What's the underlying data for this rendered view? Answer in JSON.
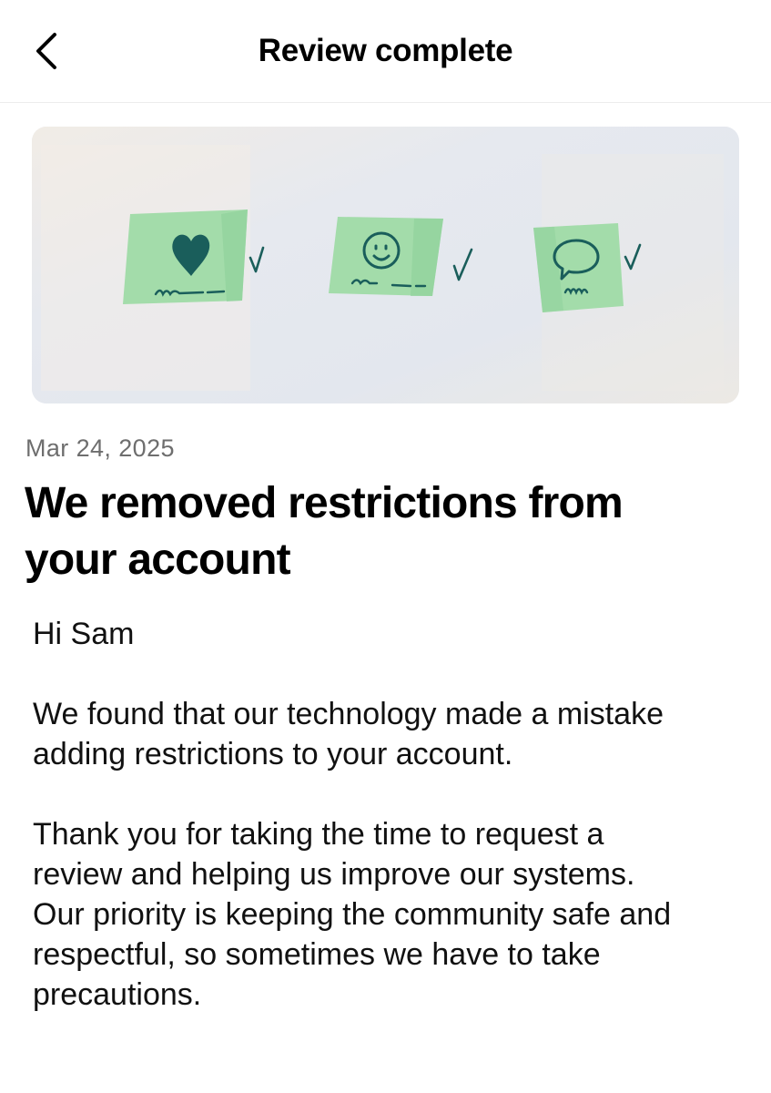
{
  "header": {
    "title": "Review complete",
    "back_icon": "chevron-left-icon"
  },
  "banner": {
    "background_color": "#e5e8ee",
    "note_color": "#a3dcaa",
    "ink_color": "#1a5e5b",
    "icons": [
      "heart-icon",
      "smiley-icon",
      "speech-bubble-icon"
    ],
    "checkmark_glyph": "✓"
  },
  "message": {
    "date": "Mar 24, 2025",
    "headline_line1": "We removed restrictions from",
    "headline_line2": "your account",
    "greeting": "Hi Sam",
    "paragraph1_line1": "We found that our technology made a mistake",
    "paragraph1_line2": "adding restrictions to your account.",
    "paragraph2_line1": "Thank you for taking the time to request a",
    "paragraph2_line2": "review and helping us improve our systems.",
    "paragraph2_line3": "Our priority is keeping the community safe and",
    "paragraph2_line4": "respectful, so sometimes we have to take",
    "paragraph2_line5": "precautions."
  }
}
